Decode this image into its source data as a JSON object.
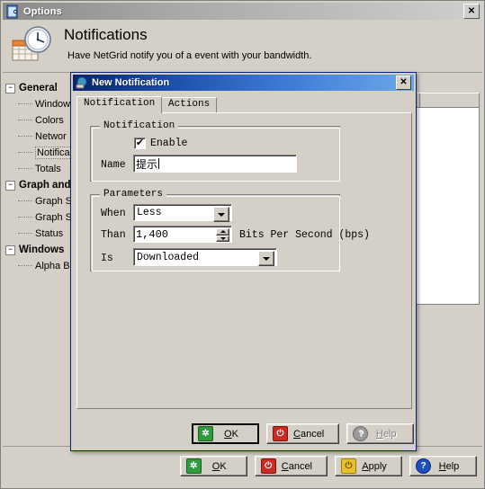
{
  "options_window": {
    "title": "Options",
    "title_icon": "options-window-icon",
    "close_icon": "✕",
    "header": {
      "icon": "calendar-clock-icon",
      "title": "Notifications",
      "subtitle": "Have NetGrid notify you of a event with your bandwidth."
    },
    "tree": {
      "groups": [
        {
          "label": "General",
          "expander": "−",
          "children": [
            {
              "label": "Window",
              "selected": false
            },
            {
              "label": "Colors",
              "selected": false
            },
            {
              "label": "Networ",
              "selected": false
            },
            {
              "label": "Notifica",
              "selected": true
            },
            {
              "label": "Totals",
              "selected": false
            }
          ]
        },
        {
          "label": "Graph and",
          "expander": "−",
          "children": [
            {
              "label": "Graph S",
              "selected": false
            },
            {
              "label": "Graph S",
              "selected": false
            },
            {
              "label": "Status",
              "selected": false
            }
          ]
        },
        {
          "label": "Windows",
          "expander": "−",
          "children": [
            {
              "label": "Alpha B",
              "selected": false
            }
          ]
        }
      ]
    },
    "list": {
      "columns": [
        "",
        ""
      ],
      "rows": []
    },
    "list_toolbar": [
      {
        "name": "add-notification-button",
        "icon": "plus-icon"
      },
      {
        "name": "remove-notification-button",
        "icon": "minus-icon"
      },
      {
        "name": "edit-notification-button",
        "icon": "edit-icon"
      }
    ],
    "buttons": [
      {
        "label": "OK",
        "accel": "O",
        "rest": "K",
        "icon": "ok-green-icon",
        "color": "#2e9b3c",
        "glyph": "✲",
        "disabled": false
      },
      {
        "label": "Cancel",
        "accel": "C",
        "rest": "ancel",
        "icon": "cancel-red-icon",
        "color": "#cc2a22",
        "glyph": "⏻",
        "disabled": false
      },
      {
        "label": "Apply",
        "accel": "A",
        "rest": "pply",
        "icon": "apply-yellow-icon",
        "color": "#e8c12a",
        "glyph": "⏻",
        "disabled": false
      },
      {
        "label": "Help",
        "accel": "H",
        "rest": "elp",
        "icon": "help-blue-icon",
        "color": "#1d4fc4",
        "glyph": "?",
        "disabled": false
      }
    ]
  },
  "dialog": {
    "title": "New Notification",
    "title_icon": "new-notification-icon",
    "close_icon": "✕",
    "tabs": [
      {
        "label": "Notification",
        "active": true
      },
      {
        "label": "Actions",
        "active": false
      }
    ],
    "notification_group": {
      "title": "Notification",
      "enable": {
        "label": "Enable",
        "checked": true,
        "check_glyph": "✔"
      },
      "name": {
        "label": "Name",
        "value": "提示"
      }
    },
    "parameters_group": {
      "title": "Parameters",
      "when": {
        "label": "When",
        "value": "Less"
      },
      "than": {
        "label": "Than",
        "value": "1,400",
        "unit": "Bits Per Second (bps)"
      },
      "is": {
        "label": "Is",
        "value": "Downloaded"
      }
    },
    "buttons": [
      {
        "label": "OK",
        "accel": "O",
        "rest": "K",
        "icon": "ok-green-icon",
        "color": "#2e9b3c",
        "glyph": "✲",
        "disabled": false,
        "default": true
      },
      {
        "label": "Cancel",
        "accel": "C",
        "rest": "ancel",
        "icon": "cancel-red-icon",
        "color": "#cc2a22",
        "glyph": "⏻",
        "disabled": false,
        "default": false
      },
      {
        "label": "Help",
        "accel": "H",
        "rest": "elp",
        "icon": "help-gray-icon",
        "color": "#9a9a9a",
        "glyph": "?",
        "disabled": true,
        "default": false
      }
    ]
  }
}
